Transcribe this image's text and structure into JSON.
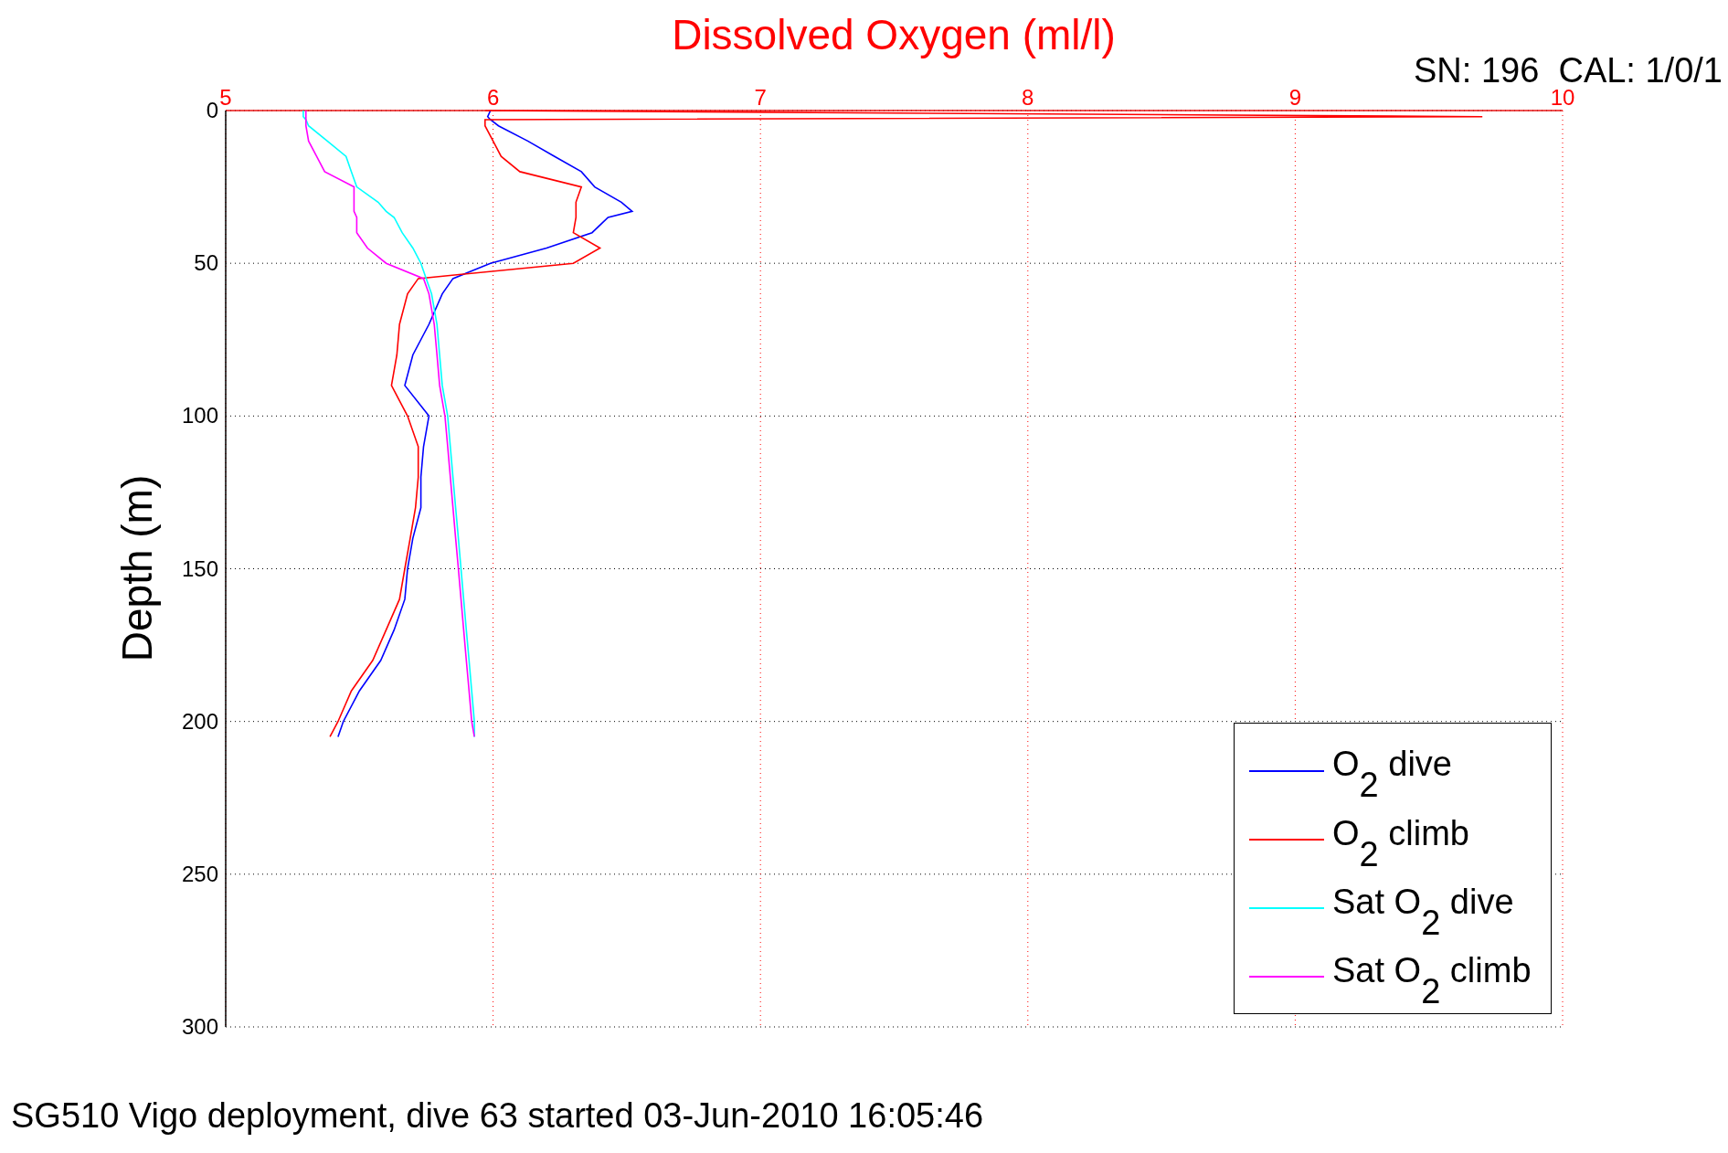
{
  "figure": {
    "calibration_label": "SN: 196  CAL: 1/0/1",
    "caption": "SG510 Vigo deployment, dive 63 started 03-Jun-2010 16:05:46",
    "chart_data": {
      "type": "line",
      "orientation": "horizontal",
      "grid": true,
      "legend": "lower right",
      "title": "Dissolved Oxygen (ml/l)",
      "ylabel": "Depth (m)",
      "x": [
        0,
        2,
        3,
        5,
        10,
        15,
        20,
        25,
        30,
        33,
        35,
        40,
        45,
        50,
        55,
        60,
        70,
        80,
        90,
        100,
        110,
        120,
        130,
        140,
        150,
        160,
        170,
        180,
        190,
        200,
        205
      ],
      "xlim": [
        5,
        10
      ],
      "xticks": [
        5,
        6,
        7,
        8,
        9,
        10
      ],
      "ylim": [
        300,
        0
      ],
      "yticks": [
        0,
        50,
        100,
        150,
        200,
        250,
        300
      ],
      "series": [
        {
          "name": "O$_{2}$ dive",
          "color": "#0000ff",
          "values": [
            5.99,
            5.98,
            5.99,
            6.02,
            6.13,
            6.23,
            6.33,
            6.38,
            6.48,
            6.52,
            6.43,
            6.37,
            6.2,
            5.99,
            5.85,
            5.81,
            5.76,
            5.7,
            5.67,
            5.76,
            5.74,
            5.73,
            5.73,
            5.7,
            5.68,
            5.67,
            5.63,
            5.58,
            5.5,
            5.44,
            5.42
          ]
        },
        {
          "name": "O$_{2}$ climb",
          "color": "#ff0000",
          "values": [
            5.97,
            9.7,
            5.97,
            5.97,
            6.0,
            6.03,
            6.1,
            6.33,
            6.31,
            6.31,
            6.31,
            6.3,
            6.4,
            6.3,
            5.72,
            5.68,
            5.65,
            5.64,
            5.62,
            5.68,
            5.72,
            5.72,
            5.71,
            5.69,
            5.67,
            5.65,
            5.6,
            5.55,
            5.47,
            5.42,
            5.39
          ]
        },
        {
          "name": "Sat O$_{2}$ dive",
          "color": "#00ffff",
          "values": [
            5.29,
            5.29,
            5.3,
            5.31,
            5.38,
            5.45,
            5.47,
            5.49,
            5.57,
            5.6,
            5.63,
            5.66,
            5.7,
            5.73,
            5.75,
            5.77,
            5.79,
            5.8,
            5.81,
            5.83,
            5.84,
            5.85,
            5.86,
            5.87,
            5.88,
            5.89,
            5.9,
            5.91,
            5.92,
            5.93,
            5.93
          ]
        },
        {
          "name": "Sat O$_{2}$ climb",
          "color": "#ff00ff",
          "values": [
            5.3,
            5.3,
            5.3,
            5.3,
            5.31,
            5.34,
            5.37,
            5.48,
            5.48,
            5.48,
            5.49,
            5.49,
            5.53,
            5.6,
            5.74,
            5.76,
            5.78,
            5.79,
            5.8,
            5.82,
            5.83,
            5.84,
            5.85,
            5.86,
            5.87,
            5.88,
            5.89,
            5.9,
            5.91,
            5.92,
            5.93
          ]
        }
      ]
    }
  }
}
